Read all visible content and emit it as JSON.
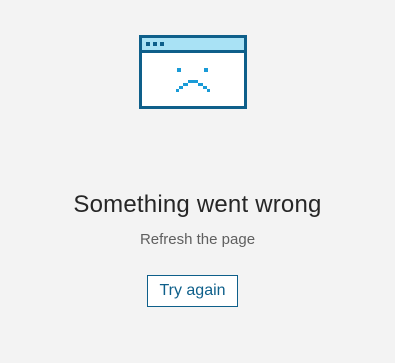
{
  "error": {
    "illustration_icon": "sad-browser-window-icon",
    "title": "Something went wrong",
    "message": "Refresh the page",
    "retry_label": "Try again"
  },
  "colors": {
    "background": "#f3f3f3",
    "accent": "#0e5f8a",
    "window_header": "#a9e2f5",
    "title_text": "#262626",
    "message_text": "#5f5f5f"
  }
}
